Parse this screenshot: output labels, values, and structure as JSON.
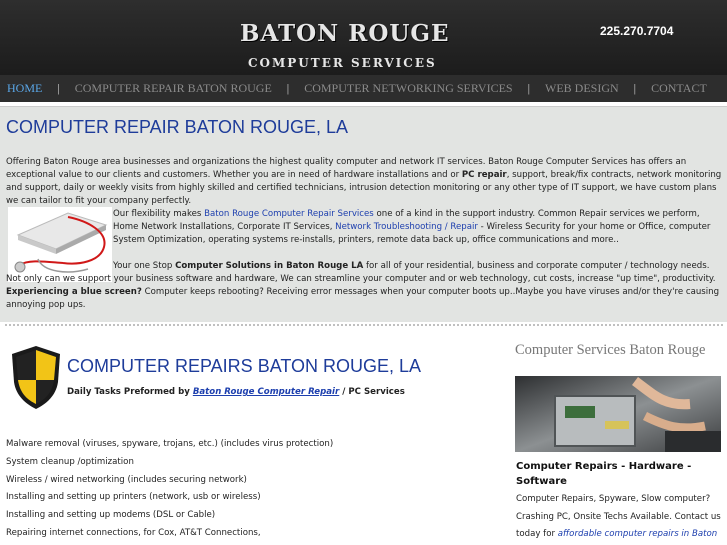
{
  "header": {
    "logo_main": "BATON ROUGE",
    "logo_sub": "COMPUTER SERVICES",
    "phone": "225.270.7704"
  },
  "nav": {
    "items": [
      "HOME",
      "COMPUTER REPAIR BATON ROUGE",
      "COMPUTER NETWORKING SERVICES",
      "WEB DESIGN",
      "CONTACT"
    ],
    "active": "HOME",
    "separator": "|"
  },
  "main": {
    "title": "COMPUTER REPAIR BATON ROUGE, LA",
    "p1": {
      "a": "Offering Baton Rouge area businesses and organizations the highest quality computer and network IT services. Baton Rouge Computer Services has offers an exceptional value to our clients and customers. Whether you are in need of hardware installations and or ",
      "bold": "PC repair",
      "b": ", support, break/fix contracts, network monitoring and support, daily or weekly visits from highly skilled and certified technicians, intrusion detection monitoring or any other type of IT support, we have custom plans we can tailor to fit your company perfectly."
    },
    "p2": {
      "a": "Our flexibility makes ",
      "link1": "Baton Rouge Computer Repair Services",
      "b": " one of a kind in the support industry. Common Repair services we perform, Home Network Installations, Corporate IT Services, ",
      "link2": "Network Troubleshooting / Repair",
      "c": " - Wireless Security for your home or Office, computer System Optimization, operating systems re-installs, printers, remote data back up, office communications and more.."
    },
    "p3": {
      "a": "Your one Stop ",
      "bold1": "Computer Solutions in Baton Rouge LA",
      "b": " for all of your residential, business and corporate computer / technology needs. Not only can we support your business software and hardware,  We can streamline your computer and or web technology, cut costs, increase \"up time\", productivity. ",
      "bold2": "Experiencing a blue screen?",
      "c": " Computer keeps rebooting? Receiving error messages when your computer boots up..Maybe you have viruses and/or they're causing annoying pop ups."
    }
  },
  "section2": {
    "title": "COMPUTER REPAIRS BATON ROUGE, LA",
    "daily_prefix": "Daily Tasks Preformed by ",
    "daily_link": "Baton Rouge Computer Repair",
    "daily_suffix": " / PC Services",
    "tasks": [
      "Malware removal (viruses, spyware, trojans, etc.) (includes virus protection)",
      "System cleanup /optimization",
      "Wireless / wired networking (includes securing network)",
      "Installing and setting up printers (network, usb or wireless)",
      "Installing and setting up modems (DSL or Cable)",
      "Repairing internet connections, for Cox, AT&T Connections,"
    ]
  },
  "sidebar": {
    "title": "Computer Services Baton Rouge",
    "heading": "Computer Repairs - Hardware - Software",
    "text_a": "Computer Repairs, Spyware, Slow computer? Crashing PC, Onsite Techs Available. Contact us today for ",
    "text_italic": "affordable computer repairs in Baton"
  },
  "colors": {
    "header_bg": "#222222",
    "nav_active": "#5aa7e8",
    "title_blue": "#1e3c9a",
    "link_blue": "#1d3fae",
    "content_bg": "#e2e4e2"
  },
  "icons": [
    "laptop-stethoscope-image",
    "shield-icon",
    "computer-hardware-photo"
  ]
}
